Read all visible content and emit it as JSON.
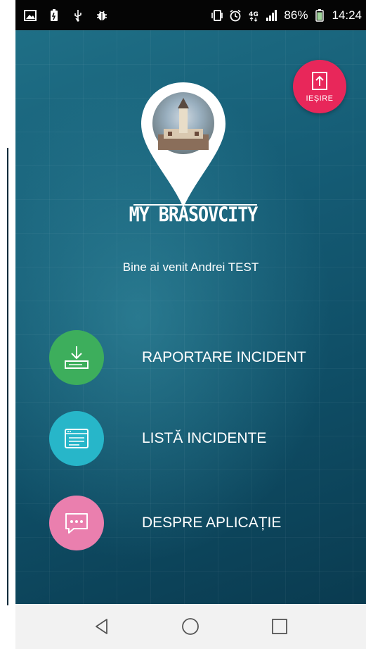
{
  "status_bar": {
    "battery": "86%",
    "time": "14:24",
    "network": "4G",
    "icons": [
      "image-icon",
      "battery-saver-icon",
      "usb-icon",
      "bug-icon",
      "vibrate-icon",
      "alarm-icon",
      "network-4g-icon",
      "signal-icon",
      "battery-icon"
    ]
  },
  "app": {
    "logo_text": "MY BRASOVCITY",
    "welcome_text": "Bine ai venit Andrei TEST",
    "exit_label": "IEȘIRE"
  },
  "menu": [
    {
      "label": "RAPORTARE INCIDENT",
      "color": "#3dae5c",
      "icon": "download-icon"
    },
    {
      "label": "LISTĂ INCIDENTE",
      "color": "#27b6c9",
      "icon": "list-window-icon"
    },
    {
      "label": "DESPRE APLICAȚIE",
      "color": "#ea7fae",
      "icon": "chat-bubble-icon"
    }
  ],
  "nav": {
    "icons": [
      "back-icon",
      "home-icon",
      "recents-icon"
    ]
  },
  "colors": {
    "exit_button": "#e8275a",
    "background": "#155c75",
    "nav_bar": "#f2f2f2"
  }
}
